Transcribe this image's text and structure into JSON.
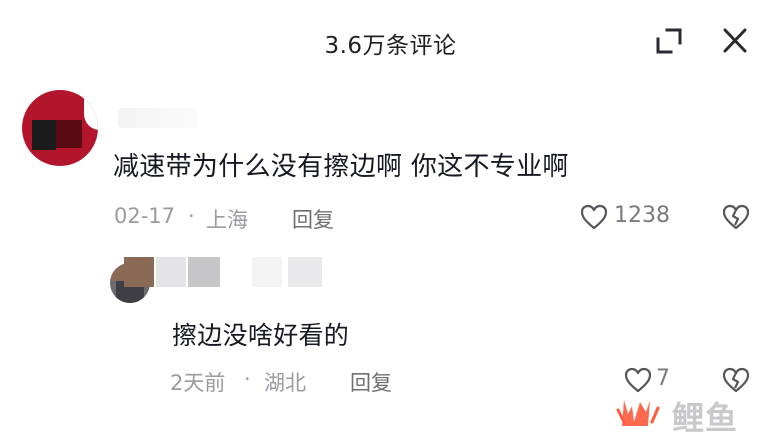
{
  "header": {
    "title": "3.6万条评论",
    "expand_icon": "expand-icon",
    "close_icon": "close-icon"
  },
  "comment": {
    "text": "减速带为什么没有擦边啊  你这不专业啊",
    "date": "02-17",
    "separator": "·",
    "location": "上海",
    "reply_label": "回复",
    "like_count": "1238"
  },
  "reply": {
    "text": "擦边没啥好看的",
    "date": "2天前",
    "separator": "·",
    "location": "湖北",
    "reply_label": "回复",
    "like_count": "7"
  },
  "watermark": {
    "text": "鲤鱼"
  },
  "colors": {
    "text_primary": "#161823",
    "text_meta": "#9a9aa2",
    "icon": "#4a4a52",
    "watermark": "#ff5a3c"
  }
}
